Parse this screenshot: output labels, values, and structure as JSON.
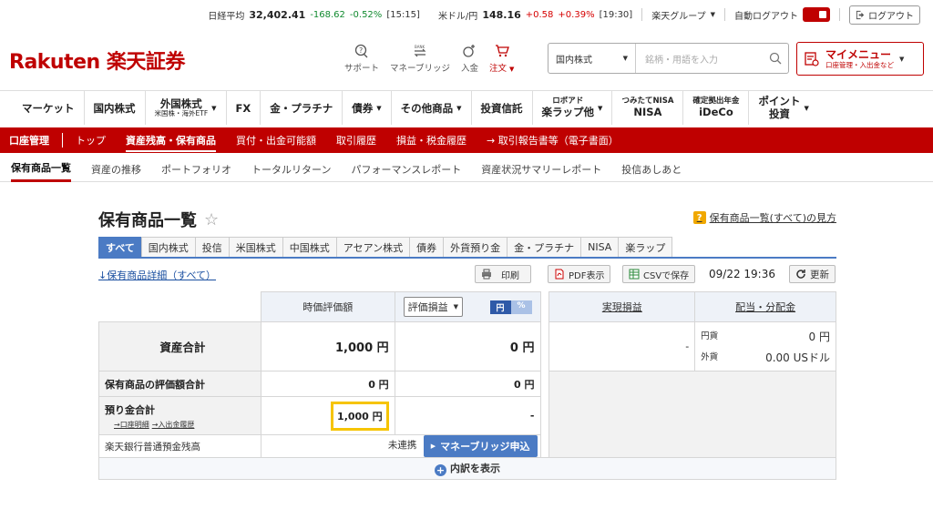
{
  "ticker": {
    "nikkei_label": "日経平均",
    "nikkei_value": "32,402.41",
    "nikkei_change": "-168.62",
    "nikkei_pct": "-0.52%",
    "nikkei_time": "[15:15]",
    "usd_label": "米ドル/円",
    "usd_value": "148.16",
    "usd_change": "+0.58",
    "usd_pct": "+0.39%",
    "usd_time": "[19:30]",
    "group_label": "楽天グループ",
    "autologout_label": "自動ログアウト",
    "logout_label": "ログアウト"
  },
  "header": {
    "logo_text": "Rakuten 楽天証券",
    "support": "サポート",
    "money_bridge": "マネーブリッジ",
    "money_bridge_icon_text": "BANK",
    "deposit": "入金",
    "order": "注文",
    "search_select": "国内株式",
    "search_placeholder": "銘柄・用語を入力",
    "mymenu_title": "マイメニュー",
    "mymenu_sub": "口座管理・入出金など"
  },
  "mainnav": {
    "market": "マーケット",
    "domestic": "国内株式",
    "foreign_main": "外国株式",
    "foreign_sub": "米国株・海外ETF",
    "fx": "FX",
    "gold": "金・プラチナ",
    "bond": "債券",
    "other": "その他商品",
    "fund": "投資信託",
    "robo_top": "ロボアド",
    "robo_bottom": "楽ラップ他",
    "nisa_top": "つみたてNISA",
    "nisa_bottom": "NISA",
    "ideco_top": "確定拠出年金",
    "ideco_bottom": "iDeCo",
    "point_top": "ポイント",
    "point_bottom": "投資"
  },
  "rednav": {
    "account": "口座管理",
    "top": "トップ",
    "holdings": "資産残高・保有商品",
    "buying_power": "買付・出金可能額",
    "history": "取引履歴",
    "tax": "損益・税金履歴",
    "report": "→ 取引報告書等（電子書面）"
  },
  "subnav": {
    "list": "保有商品一覧",
    "trend": "資産の推移",
    "portfolio": "ポートフォリオ",
    "total_return": "トータルリターン",
    "performance": "パフォーマンスレポート",
    "summary_report": "資産状況サマリーレポート",
    "footprint": "投信あしあと"
  },
  "page": {
    "title": "保有商品一覧",
    "howto": "保有商品一覧(すべて)の見方",
    "howto_icon": "?",
    "detail_link": "↓保有商品詳細（すべて）",
    "print": "印刷",
    "pdf": "PDF表示",
    "csv": "CSVで保存",
    "timestamp": "09/22 19:36",
    "refresh": "更新"
  },
  "tabs": [
    "すべて",
    "国内株式",
    "投信",
    "米国株式",
    "中国株式",
    "アセアン株式",
    "債券",
    "外貨預り金",
    "金・プラチナ",
    "NISA",
    "楽ラップ"
  ],
  "table": {
    "col_market_value": "時価評価額",
    "col_pl_select": "評価損益",
    "toggle_yen": "円",
    "toggle_pct": "%",
    "col_realized": "実現損益",
    "col_dividend": "配当・分配金",
    "row_total_label": "資産合計",
    "row_total_value": "1,000 円",
    "row_total_pl": "0 円",
    "row_total_realized": "-",
    "div_yen_label": "円貨",
    "div_yen_value": "0 円",
    "div_usd_label": "外貨",
    "div_usd_value": "0.00 USドル",
    "row_holdings_label": "保有商品の評価額合計",
    "row_holdings_value": "0 円",
    "row_holdings_pl": "0 円",
    "row_deposit_label": "預り金合計",
    "row_deposit_link1": "→口座明細",
    "row_deposit_link2": "→入出金履歴",
    "row_deposit_value": "1,000 円",
    "row_deposit_pl": "-",
    "row_bank_label": "楽天銀行普通預金残高",
    "row_bank_status": "未連携",
    "row_bank_button": "マネーブリッジ申込",
    "expand_label": "内訳を表示"
  }
}
